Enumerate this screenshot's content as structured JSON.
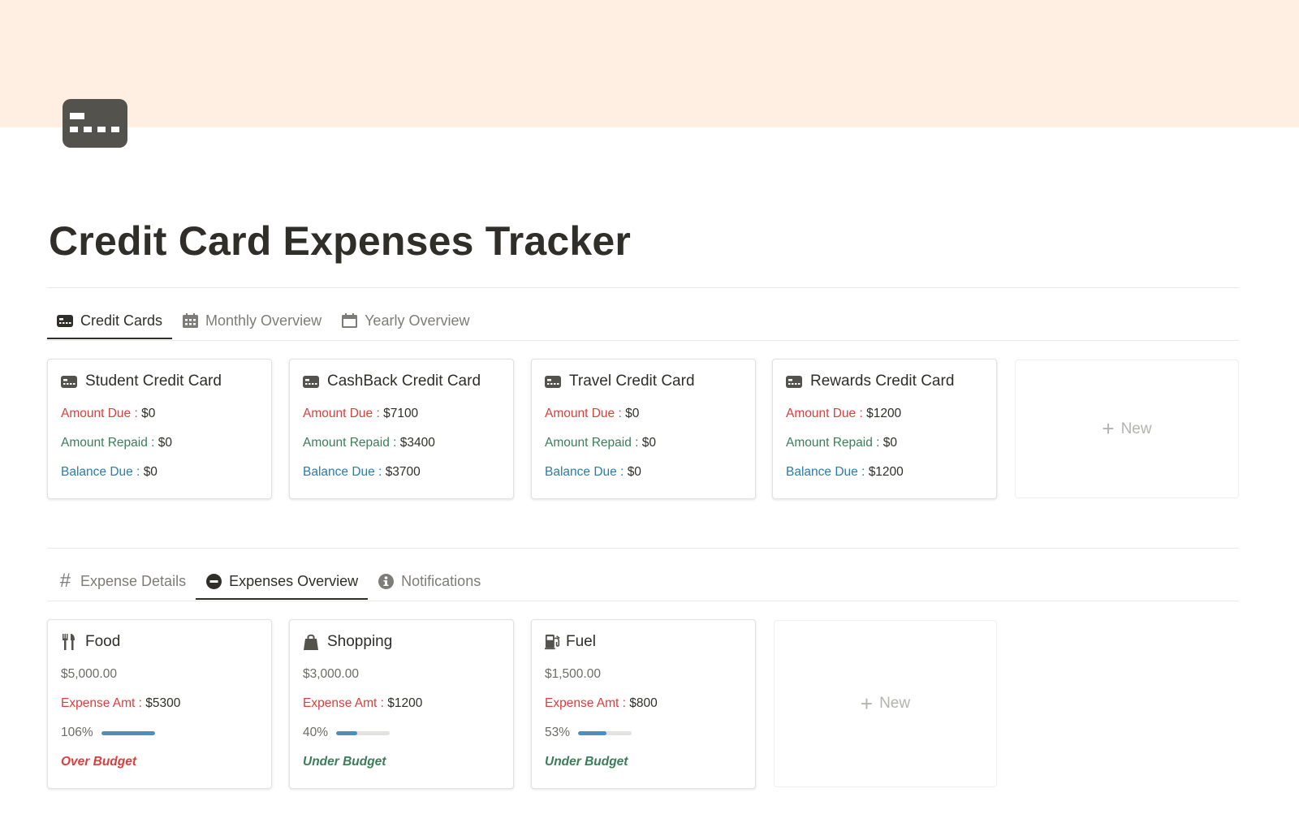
{
  "page": {
    "title": "Credit Card Expenses Tracker",
    "icon": "credit-card-icon",
    "cover_color": "#ffefe2"
  },
  "top_tabs": [
    {
      "label": "Credit Cards",
      "icon": "credit-card-icon",
      "active": true
    },
    {
      "label": "Monthly Overview",
      "icon": "calendar-grid-icon",
      "active": false
    },
    {
      "label": "Yearly Overview",
      "icon": "calendar-icon",
      "active": false
    }
  ],
  "credit_cards": {
    "labels": {
      "amount_due": "Amount Due : ",
      "amount_repaid": "Amount Repaid : ",
      "balance_due": "Balance Due : "
    },
    "items": [
      {
        "name": "Student Credit Card",
        "amount_due": "$0",
        "amount_repaid": "$0",
        "balance_due": "$0"
      },
      {
        "name": "CashBack Credit Card",
        "amount_due": "$7100",
        "amount_repaid": "$3400",
        "balance_due": "$3700"
      },
      {
        "name": "Travel Credit Card",
        "amount_due": "$0",
        "amount_repaid": "$0",
        "balance_due": "$0"
      },
      {
        "name": "Rewards Credit Card",
        "amount_due": "$1200",
        "amount_repaid": "$0",
        "balance_due": "$1200"
      }
    ],
    "new_label": "New"
  },
  "bottom_tabs": [
    {
      "label": "Expense Details",
      "icon": "hash-icon",
      "active": false
    },
    {
      "label": "Expenses Overview",
      "icon": "minus-circle-icon",
      "active": true
    },
    {
      "label": "Notifications",
      "icon": "info-circle-icon",
      "active": false
    }
  ],
  "expenses": {
    "labels": {
      "expense_amt": "Expense Amt : "
    },
    "items": [
      {
        "name": "Food",
        "icon": "fork-knife-icon",
        "budget": "$5,000.00",
        "expense_amt": "$5300",
        "percent_label": "106%",
        "percent": 106,
        "status": "Over Budget",
        "status_color": "#d93f3c"
      },
      {
        "name": "Shopping",
        "icon": "shopping-bag-icon",
        "budget": "$3,000.00",
        "expense_amt": "$1200",
        "percent_label": "40%",
        "percent": 40,
        "status": "Under Budget",
        "status_color": "#3c7d59"
      },
      {
        "name": "Fuel",
        "icon": "gas-pump-icon",
        "budget": "$1,500.00",
        "expense_amt": "$800",
        "percent_label": "53%",
        "percent": 53,
        "status": "Under Budget",
        "status_color": "#3c7d59"
      }
    ],
    "new_label": "New"
  },
  "colors": {
    "label_red": "#d93f3c",
    "label_green": "#3c7d59",
    "label_blue": "#2b7bb0",
    "progress_fill": "#4b8ec0"
  }
}
